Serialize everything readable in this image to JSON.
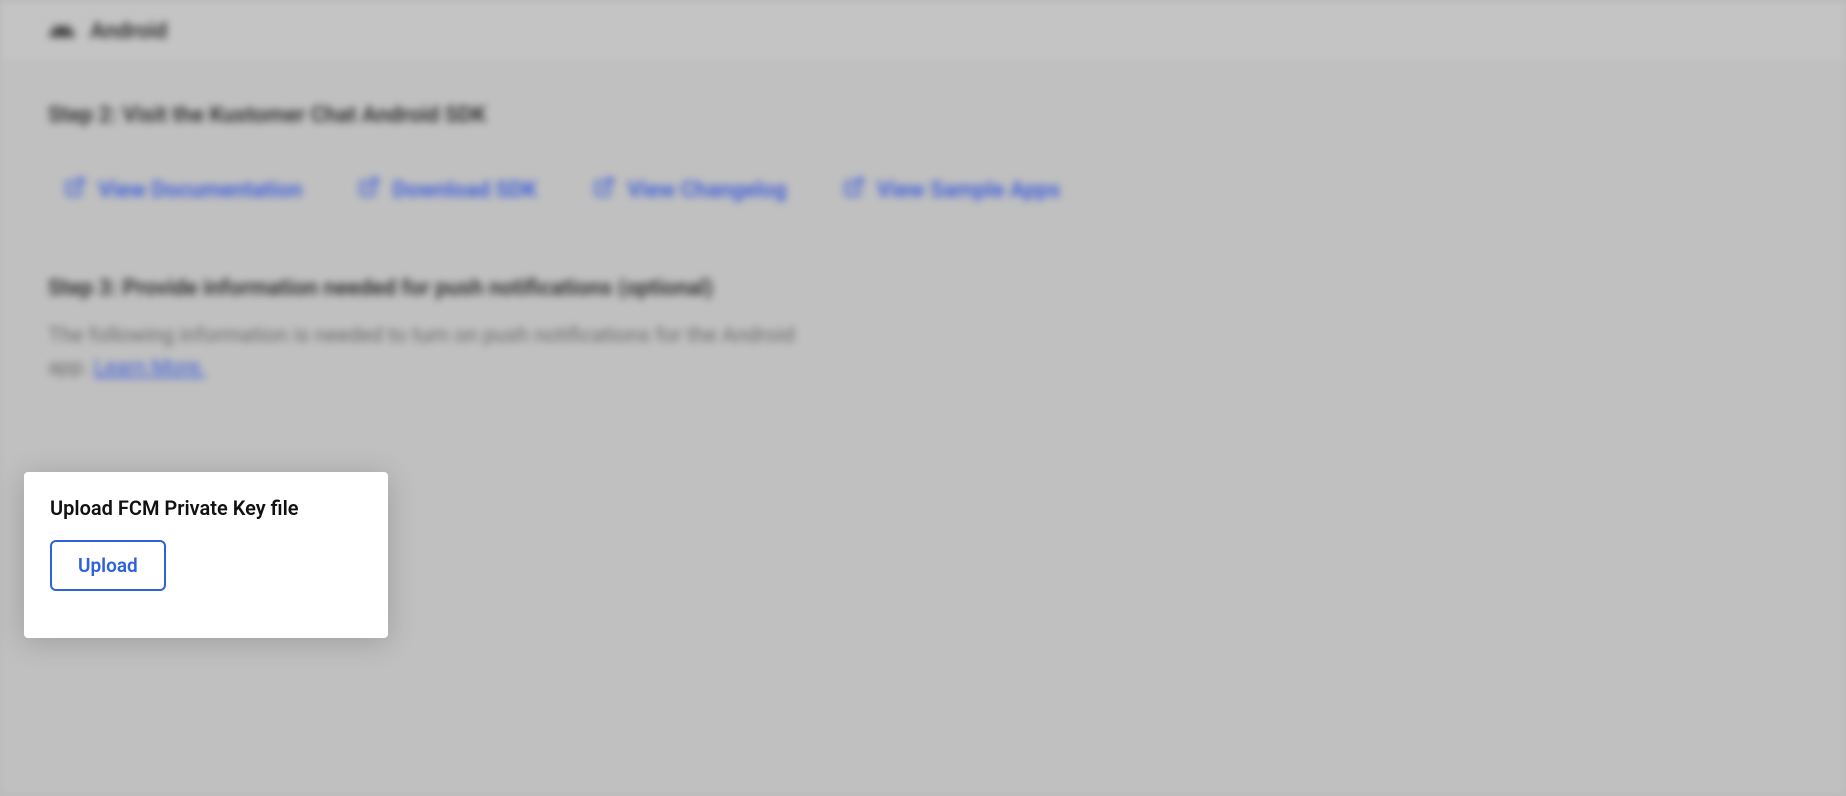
{
  "header": {
    "title": "Android"
  },
  "step2": {
    "heading": "Step 2: Visit the Kustomer Chat Android SDK",
    "links": [
      {
        "label": "View Documentation"
      },
      {
        "label": "Download SDK"
      },
      {
        "label": "View Changelog"
      },
      {
        "label": "View Sample Apps"
      }
    ]
  },
  "step3": {
    "heading": "Step 3: Provide information needed for push notifications (optional)",
    "description": "The following information is needed to turn on push notifications for the Android app. ",
    "learn_more": "Learn More."
  },
  "upload": {
    "label": "Upload FCM Private Key file",
    "button_label": "Upload"
  }
}
